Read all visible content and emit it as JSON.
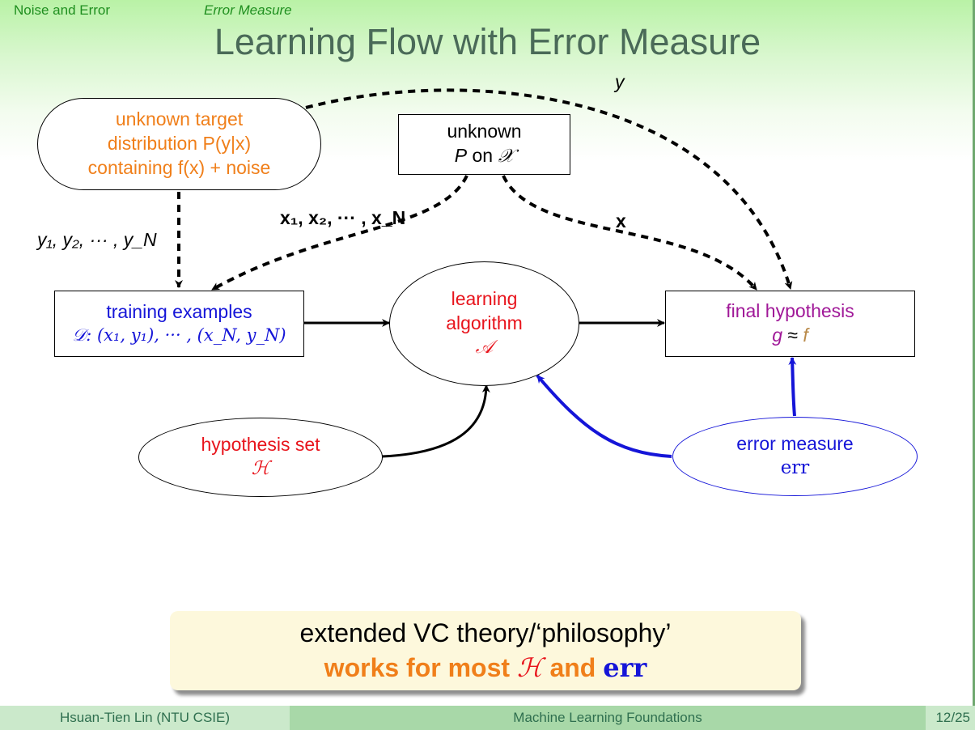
{
  "header": {
    "section": "Noise and Error",
    "subsection": "Error Measure"
  },
  "title": "Learning Flow with Error Measure",
  "nodes": {
    "target": {
      "line1": "unknown target",
      "line2": "distribution P(y|x)",
      "line3_a": "containing f(x)",
      "line3_b": "+ noise"
    },
    "px": {
      "line1": "unknown",
      "line2_a": "P",
      "line2_b": "on",
      "line2_c": "𝒳"
    },
    "training": {
      "line1": "training examples",
      "line2": "𝒟: (x₁, y₁), ··· , (x_N, y_N)"
    },
    "algorithm": {
      "line1": "learning",
      "line2": "algorithm",
      "line3": "𝒜"
    },
    "final": {
      "line1": "final hypothesis",
      "g": "g",
      "approx": "≈",
      "f": "f"
    },
    "hypothesis": {
      "line1": "hypothesis set",
      "line2": "ℋ"
    },
    "error": {
      "line1": "error measure",
      "line2": "err"
    }
  },
  "edge_labels": {
    "ys": "y₁, y₂, ··· , y_N",
    "xs": "x₁, x₂, ··· , x_N",
    "x": "x",
    "y": "y"
  },
  "callout": {
    "line1": "extended VC theory/‘philosophy’",
    "line2_a": "works for most",
    "line2_h": "ℋ",
    "line2_and": "and",
    "line2_err": "err"
  },
  "footer": {
    "author": "Hsuan-Tien Lin (NTU CSIE)",
    "course": "Machine Learning Foundations",
    "page": "12/25"
  },
  "colors": {
    "header": "#1f8f1f",
    "title": "#4a6a58",
    "target": "#f07f1a",
    "algorithm": "#e8141c",
    "training": "#1515d8",
    "final": "#a01898",
    "error_edge": "#1515d8",
    "callout_bg": "#fdf8dc"
  }
}
